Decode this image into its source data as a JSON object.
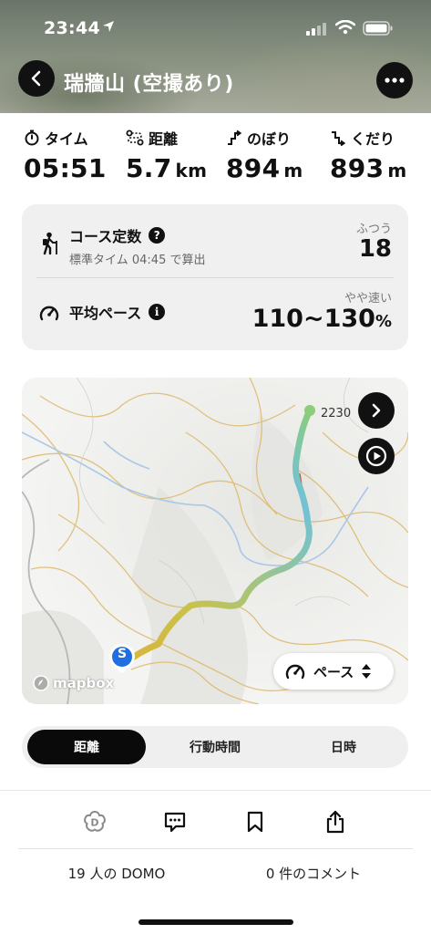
{
  "status_bar": {
    "time": "23:44"
  },
  "header": {
    "title": "瑞牆山 (空撮あり)"
  },
  "stats": [
    {
      "label": "タイム",
      "value": "05:51",
      "unit": "",
      "icon": "stopwatch-icon"
    },
    {
      "label": "距離",
      "value": "5.7",
      "unit": "km",
      "icon": "route-icon"
    },
    {
      "label": "のぼり",
      "value": "894",
      "unit": "m",
      "icon": "ascent-icon"
    },
    {
      "label": "くだり",
      "value": "893",
      "unit": "m",
      "icon": "descent-icon"
    }
  ],
  "course": {
    "title": "コース定数",
    "subtitle": "標準タイム 04:45 で算出",
    "level": "ふつう",
    "value": "18"
  },
  "pace": {
    "title": "平均ペース",
    "level": "やや速い",
    "value": "110~130",
    "unit": "%"
  },
  "map": {
    "elevation_label": "2230",
    "attribution": "mapbox",
    "pace_toggle_label": "ペース",
    "start_marker": "S"
  },
  "segments": [
    "距離",
    "行動時間",
    "日時"
  ],
  "active_segment": 0,
  "footer": {
    "domo": "19 人の DOMO",
    "comments": "0 件のコメント"
  },
  "colors": {
    "route_start": "#d9b43c",
    "route_mid": "#9cc58a",
    "route_end": "#6fc0d8",
    "accent_blue": "#1f6fe0"
  }
}
